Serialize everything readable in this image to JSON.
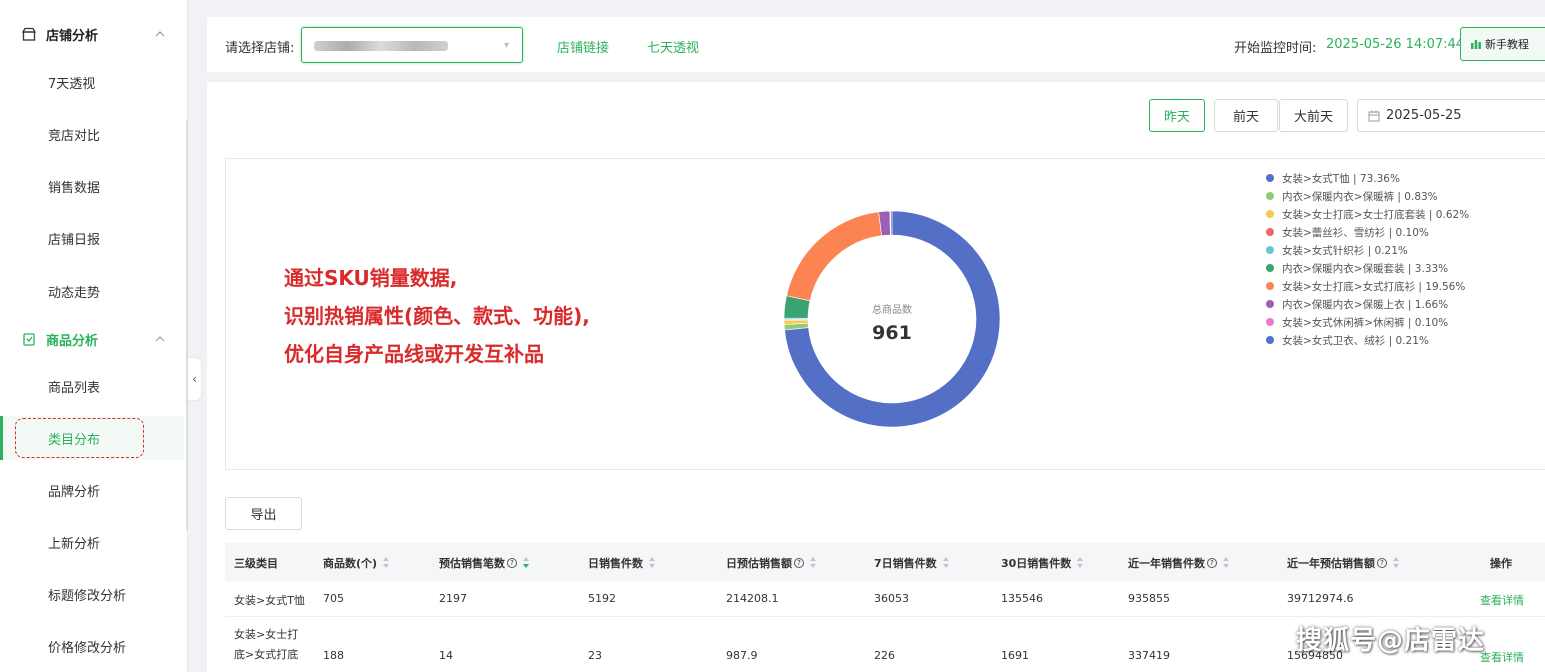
{
  "sidebar": {
    "groups": [
      {
        "label": "店铺分析",
        "icon": "store-icon"
      },
      {
        "label": "商品分析",
        "icon": "product-icon"
      }
    ],
    "store_items": [
      "7天透视",
      "竞店对比",
      "销售数据",
      "店铺日报",
      "动态走势"
    ],
    "product_items": [
      "商品列表",
      "类目分布",
      "品牌分析",
      "上新分析",
      "标题修改分析",
      "价格修改分析"
    ],
    "active_item": "类目分布"
  },
  "topbar": {
    "select_label": "请选择店铺:",
    "store_link": "店铺链接",
    "seven_day": "七天透视",
    "monitor_label": "开始监控时间:",
    "monitor_time": "2025-05-26 14:07:44",
    "guide_button": "新手教程"
  },
  "filters": {
    "yesterday": "昨天",
    "day_before": "前天",
    "three_days_ago": "大前天",
    "date": "2025-05-25"
  },
  "annotation": {
    "line1": "通过SKU销量数据,",
    "line2": "识别热销属性(颜色、款式、功能),",
    "line3": "优化自身产品线或开发互补品"
  },
  "chart_data": {
    "type": "pie",
    "center_label": "总商品数",
    "center_value": "961",
    "slices": [
      {
        "name": "女装>女式T恤",
        "percent": 73.36,
        "color": "#5470c6"
      },
      {
        "name": "内衣>保暖内衣>保暖裤",
        "percent": 0.83,
        "color": "#91cc75"
      },
      {
        "name": "女装>女士打底>女士打底套装",
        "percent": 0.62,
        "color": "#fac858"
      },
      {
        "name": "女装>蕾丝衫、雪纺衫",
        "percent": 0.1,
        "color": "#ee6666"
      },
      {
        "name": "女装>女式针织衫",
        "percent": 0.21,
        "color": "#73c0de"
      },
      {
        "name": "内衣>保暖内衣>保暖套装",
        "percent": 3.33,
        "color": "#3ba272"
      },
      {
        "name": "女装>女士打底>女式打底衫",
        "percent": 19.56,
        "color": "#fc8452"
      },
      {
        "name": "内衣>保暖内衣>保暖上衣",
        "percent": 1.66,
        "color": "#9a60b4"
      },
      {
        "name": "女装>女式休闲裤>休闲裤",
        "percent": 0.1,
        "color": "#ea7ccc"
      },
      {
        "name": "女装>女式卫衣、绒衫",
        "percent": 0.21,
        "color": "#5470c6"
      }
    ],
    "legend_text": [
      "女装>女式T恤 | 73.36%",
      "内衣>保暖内衣>保暖裤 | 0.83%",
      "女装>女士打底>女士打底套装 | 0.62%",
      "女装>蕾丝衫、雪纺衫 | 0.10%",
      "女装>女式针织衫 | 0.21%",
      "内衣>保暖内衣>保暖套装 | 3.33%",
      "女装>女士打底>女式打底衫 | 19.56%",
      "内衣>保暖内衣>保暖上衣 | 1.66%",
      "女装>女式休闲裤>休闲裤 | 0.10%",
      "女装>女式卫衣、绒衫 | 0.21%"
    ]
  },
  "export_button": "导出",
  "table": {
    "headers": [
      "三级类目",
      "商品数(个)",
      "预估销售笔数",
      "日销售件数",
      "日预估销售额",
      "7日销售件数",
      "30日销售件数",
      "近一年销售件数",
      "近一年预估销售额",
      "操作"
    ],
    "rows": [
      {
        "category": "女装>女式T恤",
        "count": "705",
        "orders": "2197",
        "daily_qty": "5192",
        "daily_amount": "214208.1",
        "qty7": "36053",
        "qty30": "135546",
        "qty_year": "935855",
        "amount_year": "39712974.6",
        "action": "查看详情"
      },
      {
        "category_l1": "女装>女士打",
        "category_l2": "底>女式打底",
        "count": "188",
        "orders": "14",
        "daily_qty": "23",
        "daily_amount": "987.9",
        "qty7": "226",
        "qty30": "1691",
        "qty_year": "337419",
        "amount_year": "15694850",
        "action": "查看详情"
      }
    ]
  },
  "watermark": "搜狐号@店雷达"
}
